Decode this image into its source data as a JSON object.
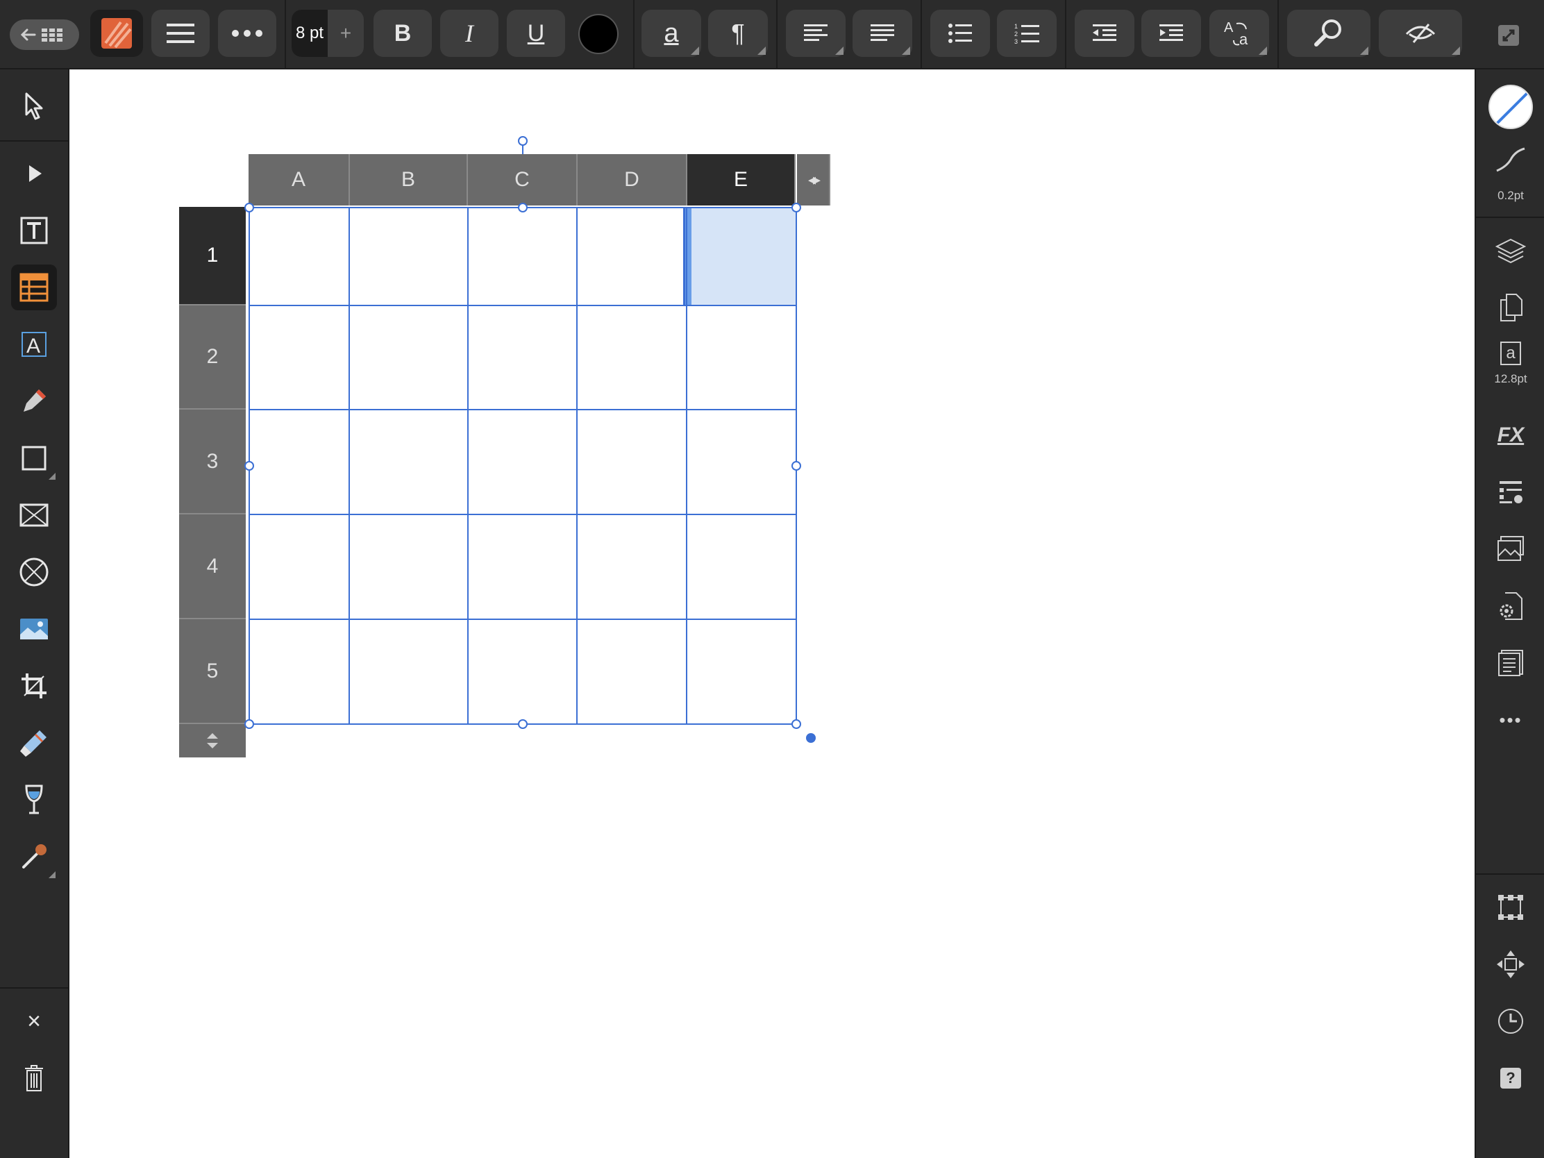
{
  "toolbar": {
    "font_size": "8 pt",
    "font_size_plus": "+",
    "bold": "B",
    "italic": "I",
    "underline": "U",
    "text_color": "#000000",
    "char_style": "a",
    "para_style": "¶",
    "icons": [
      "back-to-documents-icon",
      "app-menu-icon",
      "hamburger-menu-icon",
      "more-icon",
      "align-left-icon",
      "align-justify-icon",
      "bullet-list-icon",
      "numbered-list-icon",
      "outdent-icon",
      "indent-icon",
      "spelling-icon",
      "find-icon",
      "preview-icon",
      "persona-toggle-icon"
    ]
  },
  "tools": {
    "active": "table-tool",
    "items": [
      "move-tool",
      "node-tool",
      "frame-text-tool",
      "table-tool",
      "artistic-text-tool",
      "pen-tool",
      "rectangle-tool",
      "picture-frame-tool",
      "ellipse-frame-tool",
      "place-image-tool",
      "crop-tool",
      "vector-brush-tool",
      "fill-tool",
      "color-picker-tool"
    ],
    "close": "×",
    "delete": "trash"
  },
  "studio": {
    "stroke_width": "0.2pt",
    "text_size": "12.8pt",
    "text_glyph": "a",
    "fx": "FX",
    "help": "?",
    "more": "•••"
  },
  "table": {
    "columns": [
      "A",
      "B",
      "C",
      "D",
      "E"
    ],
    "rows": [
      "1",
      "2",
      "3",
      "4",
      "5"
    ],
    "selected_column": "E",
    "selected_row": "1",
    "selected_cell": "E1",
    "selection_color": "#d6e4f7",
    "grid_color": "#3b6fd4",
    "resize_glyph": "◂▸"
  }
}
